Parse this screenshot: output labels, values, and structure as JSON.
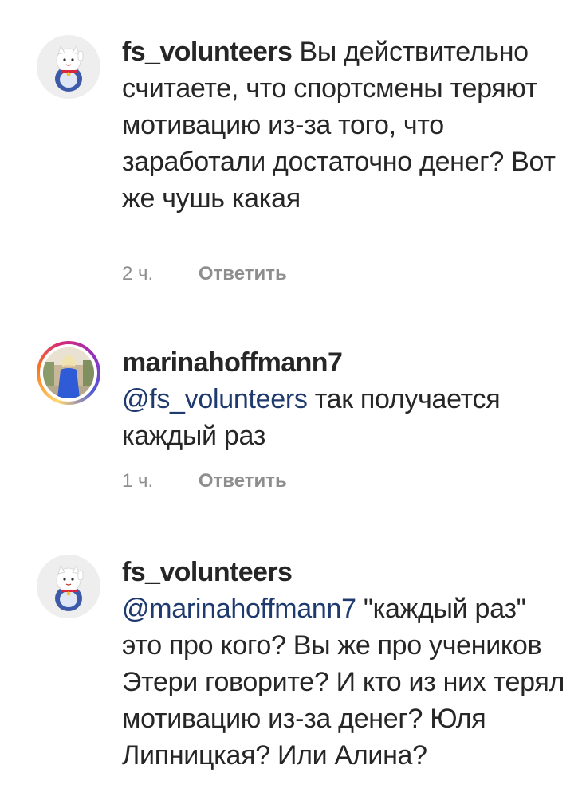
{
  "comments": [
    {
      "username": "fs_volunteers",
      "mention": "",
      "text": "Вы действительно считаете, что спортсмены теряют мотивацию из-за того, что заработали достаточно денег? Вот же чушь какая",
      "time": "2 ч.",
      "reply_label": "Ответить"
    },
    {
      "username": "marinahoffmann7",
      "mention": "@fs_volunteers",
      "text": "так получается каждый раз",
      "time": "1 ч.",
      "reply_label": "Ответить"
    },
    {
      "username": "fs_volunteers",
      "mention": "@marinahoffmann7",
      "text": "\"каждый раз\" это про кого?  Вы же про учеников Этери говорите? И кто из них терял мотивацию из-за денег? Юля Липницкая? Или Алина?"
    }
  ]
}
